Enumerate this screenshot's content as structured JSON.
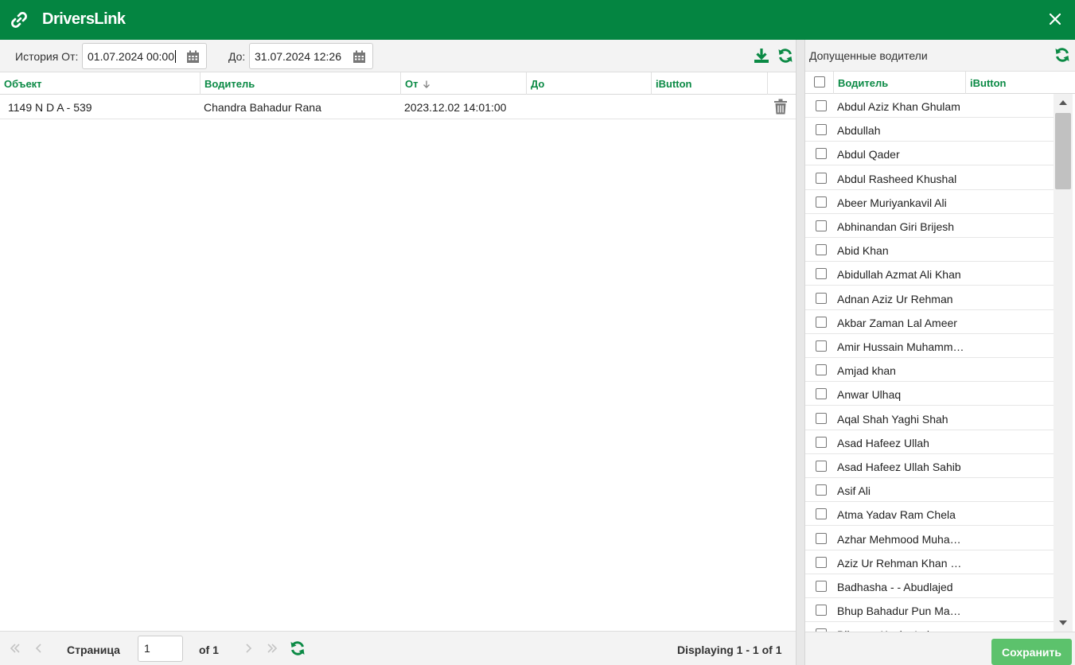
{
  "window": {
    "title": "DriversLink"
  },
  "toolbar": {
    "from_label": "История От:",
    "from_value": "01.07.2024 00:00",
    "to_label": "До:",
    "to_value": "31.07.2024 12:26"
  },
  "history_grid": {
    "columns": [
      "Объект",
      "Водитель",
      "От",
      "До",
      "iButton"
    ],
    "rows": [
      {
        "object": "1149 N D A - 539",
        "driver": "Chandra Bahadur Rana",
        "from": "2023.12.02 14:01:00",
        "to": "",
        "ibutton": ""
      }
    ]
  },
  "pager": {
    "page_label": "Страница",
    "page_value": "1",
    "of_label": "of 1",
    "displaying": "Displaying 1 - 1 of 1"
  },
  "drivers_panel": {
    "title": "Допущенные водители",
    "columns": [
      "Водитель",
      "iButton"
    ],
    "items": [
      "Abdul Aziz Khan Ghulam",
      "Abdullah",
      "Abdul Qader",
      "Abdul Rasheed Khushal",
      "Abeer Muriyankavil Ali",
      "Abhinandan Giri Brijesh",
      "Abid Khan",
      "Abidullah Azmat Ali Khan",
      "Adnan Aziz Ur Rehman",
      "Akbar Zaman Lal Ameer",
      "Amir Hussain Muhammad",
      "Amjad khan",
      "Anwar Ulhaq",
      "Aqal Shah Yaghi Shah",
      "Asad Hafeez Ullah",
      "Asad Hafeez Ullah Sahib",
      "Asif Ali",
      "Atma Yadav Ram Chela",
      "Azhar Mehmood Muhammad",
      "Aziz Ur Rehman Khan Gul",
      "Badhasha - - Abudlajed",
      "Bhup Bahadur Pun Magar",
      "Bijumon Koshy Lukose"
    ],
    "save_label": "Сохранить"
  },
  "colors": {
    "brand_green": "#048541",
    "header_text_green": "#0b8a45",
    "save_button": "#5cc26c"
  },
  "icons": {
    "title": "link-icon",
    "close": "close-icon",
    "calendar": "calendar-icon",
    "download": "download-icon",
    "refresh": "refresh-icon",
    "delete": "trash-icon",
    "sort": "sort-down-icon"
  }
}
